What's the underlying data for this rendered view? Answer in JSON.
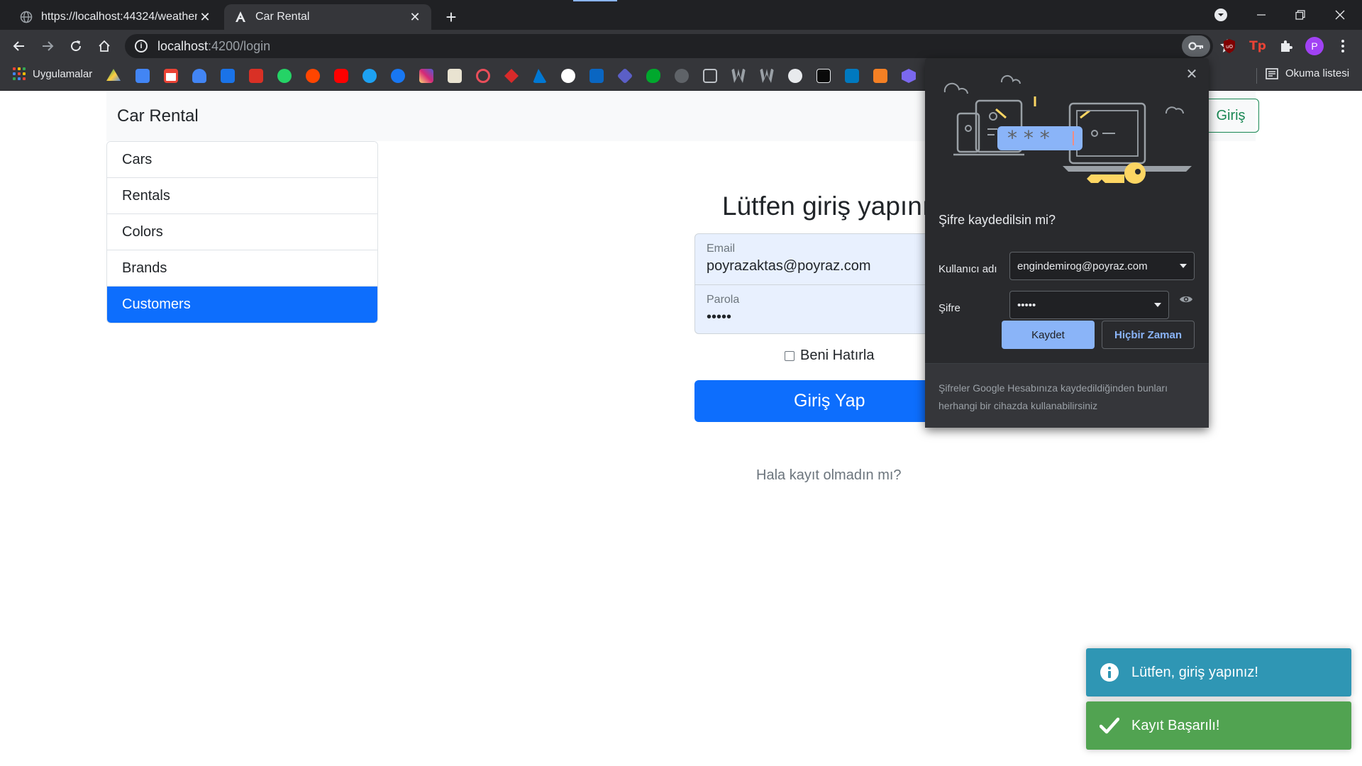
{
  "browser": {
    "tabs": [
      {
        "title": "https://localhost:44324/weatherf",
        "active": false
      },
      {
        "title": "Car Rental",
        "active": true
      }
    ],
    "address": {
      "host": "localhost",
      "path": ":4200/login"
    },
    "bookmarks": {
      "apps_label": "Uygulamalar",
      "reading_list_label": "Okuma listesi"
    },
    "profile_initial": "P"
  },
  "app": {
    "brand": "Car Rental",
    "nav_login_label": "Giriş",
    "menu": [
      {
        "label": "Cars",
        "active": false
      },
      {
        "label": "Rentals",
        "active": false
      },
      {
        "label": "Colors",
        "active": false
      },
      {
        "label": "Brands",
        "active": false
      },
      {
        "label": "Customers",
        "active": true
      }
    ]
  },
  "login": {
    "title": "Lütfen giriş yapınız",
    "email_label": "Email",
    "email_value": "poyrazaktas@poyraz.com",
    "password_label": "Parola",
    "password_value": "•••••",
    "remember_label": "Beni Hatırla",
    "submit_label": "Giriş Yap",
    "register_text": "Hala kayıt olmadın mı?"
  },
  "save_password_popup": {
    "title": "Şifre kaydedilsin mi?",
    "username_label": "Kullanıcı adı",
    "username_value": "engindemirog@poyraz.com",
    "password_label": "Şifre",
    "password_value": "•••••",
    "save_label": "Kaydet",
    "never_label": "Hiçbir Zaman",
    "footer_text": "Şifreler Google Hesabınıza kaydedildiğinden bunları herhangi bir cihazda kullanabilirsiniz"
  },
  "toasts": [
    {
      "type": "info",
      "text": "Lütfen, giriş yapınız!",
      "icon": "info-circle-icon"
    },
    {
      "type": "success",
      "text": "Kayıt Başarılı!",
      "icon": "check-icon"
    }
  ],
  "colors": {
    "primary": "#0d6efd",
    "success": "#198754",
    "toast_info": "#2f96b4",
    "toast_success": "#51a351",
    "chrome_dark": "#202124",
    "chrome_toolbar": "#35363a",
    "popup_accent": "#8ab4f8"
  }
}
